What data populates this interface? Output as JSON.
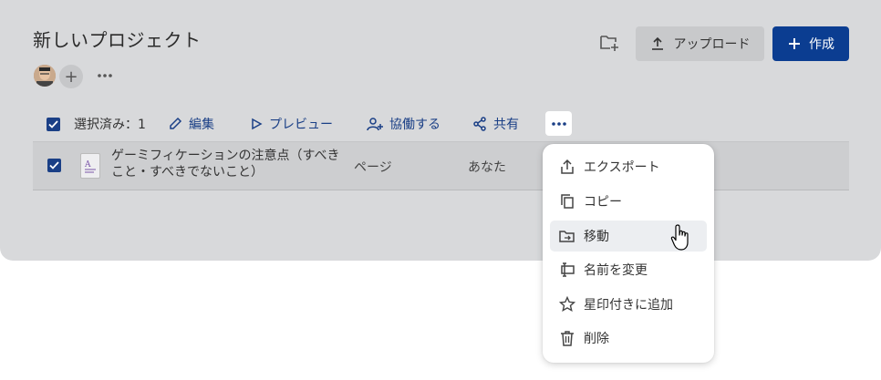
{
  "project": {
    "title": "新しいプロジェクト"
  },
  "header": {
    "upload_label": "アップロード",
    "create_label": "作成"
  },
  "toolbar": {
    "selected_label": "選択済み：1",
    "edit_label": "編集",
    "preview_label": "プレビュー",
    "collaborate_label": "協働する",
    "share_label": "共有"
  },
  "file_row": {
    "name": "ゲーミフィケーションの注意点（すべきこと・すべきでないこと）",
    "type": "ページ",
    "owner": "あなた"
  },
  "context_menu": {
    "export_label": "エクスポート",
    "copy_label": "コピー",
    "move_label": "移動",
    "rename_label": "名前を変更",
    "star_label": "星印付きに追加",
    "delete_label": "削除"
  },
  "colors": {
    "accent": "#1a3f86",
    "primary_button": "#0b3d91",
    "overlay": "#d8d9db"
  }
}
